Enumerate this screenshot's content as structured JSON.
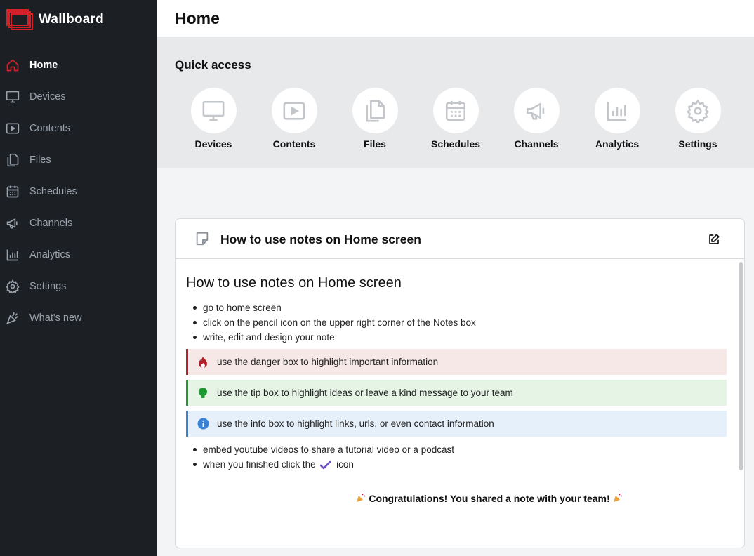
{
  "brand": {
    "name": "Wallboard",
    "logo_color": "#d42027"
  },
  "sidebar": {
    "items": [
      {
        "label": "Home",
        "icon": "home-icon",
        "active": true
      },
      {
        "label": "Devices",
        "icon": "monitor-icon"
      },
      {
        "label": "Contents",
        "icon": "play-icon"
      },
      {
        "label": "Files",
        "icon": "files-icon"
      },
      {
        "label": "Schedules",
        "icon": "calendar-icon"
      },
      {
        "label": "Channels",
        "icon": "megaphone-icon"
      },
      {
        "label": "Analytics",
        "icon": "bar-chart-icon"
      },
      {
        "label": "Settings",
        "icon": "gear-icon"
      },
      {
        "label": "What's new",
        "icon": "party-popper-icon"
      }
    ]
  },
  "header": {
    "title": "Home"
  },
  "quick_access": {
    "title": "Quick access",
    "items": [
      {
        "label": "Devices",
        "icon": "monitor-icon"
      },
      {
        "label": "Contents",
        "icon": "play-icon"
      },
      {
        "label": "Files",
        "icon": "files-icon"
      },
      {
        "label": "Schedules",
        "icon": "calendar-icon"
      },
      {
        "label": "Channels",
        "icon": "megaphone-icon"
      },
      {
        "label": "Analytics",
        "icon": "bar-chart-icon"
      },
      {
        "label": "Settings",
        "icon": "gear-icon"
      }
    ]
  },
  "note": {
    "card_title": "How to use notes on Home screen",
    "heading": "How to use notes on Home screen",
    "list_top": [
      "go to home screen",
      "click on the pencil icon on the upper right corner of the Notes box",
      "write, edit and design your note"
    ],
    "danger_box": "use the danger box to highlight important information",
    "tip_box": "use the tip box to highlight ideas or leave a kind message to your team",
    "info_box": "use the info box to highlight links, urls, or even contact information",
    "list_bottom_1": "embed youtube videos to share a tutorial video or a podcast",
    "list_bottom_2_before": "when you finished click the",
    "list_bottom_2_after": "icon",
    "congrats": "Congratulations! You shared a note with your team!"
  },
  "colors": {
    "sidebar_bg": "#1c1f23",
    "active_icon": "#d42027",
    "danger": "#b32028",
    "tip": "#1f9a32",
    "info": "#3b82d6",
    "check": "#6a4fc4"
  }
}
